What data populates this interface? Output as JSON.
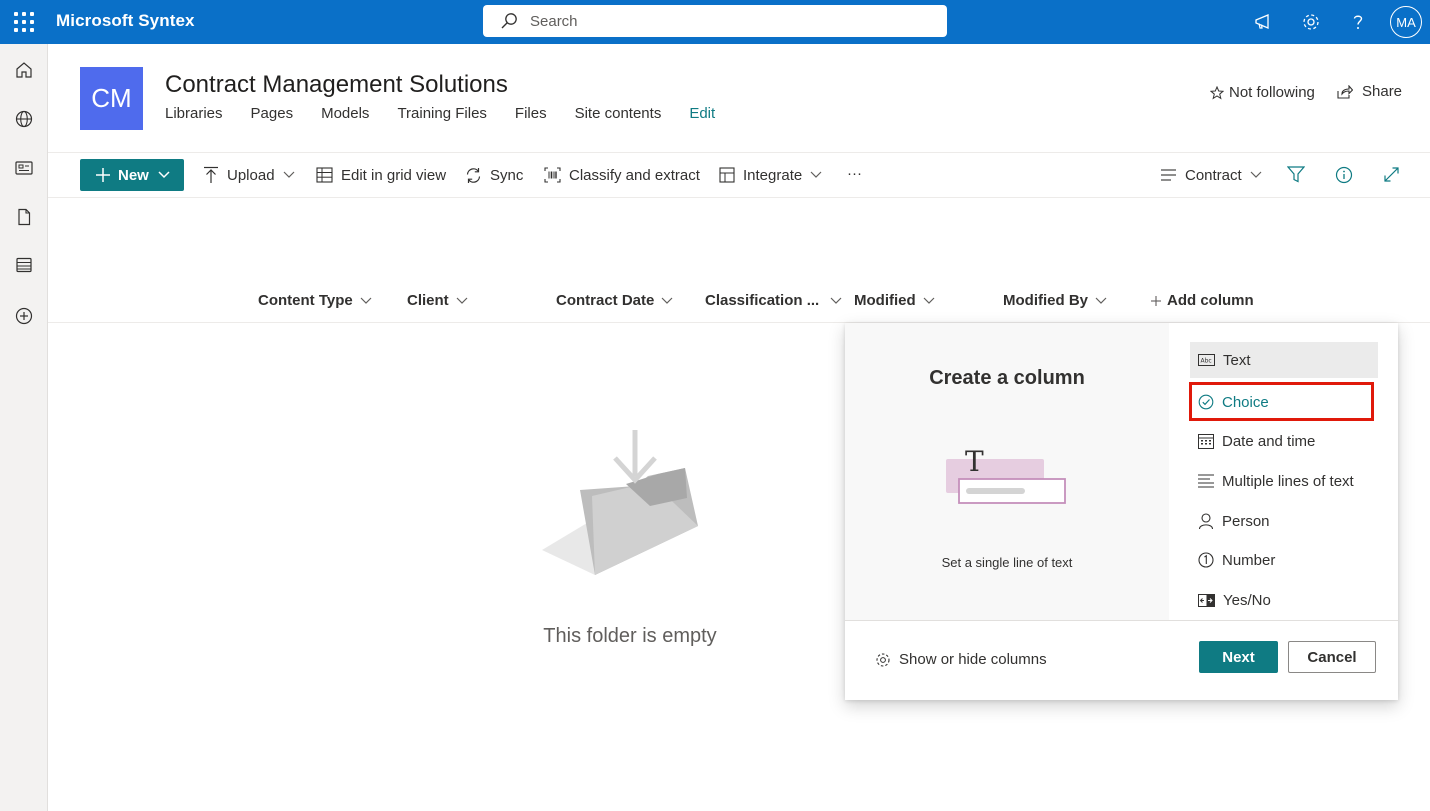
{
  "suitebar": {
    "app_name": "Microsoft Syntex",
    "search_placeholder": "Search",
    "avatar_initials": "MA"
  },
  "site": {
    "logo_text": "CM",
    "title": "Contract Management Solutions",
    "nav": [
      "Libraries",
      "Pages",
      "Models",
      "Training Files",
      "Files",
      "Site contents",
      "Edit"
    ],
    "follow_label": "Not following",
    "share_label": "Share"
  },
  "commandbar": {
    "new_label": "New",
    "upload_label": "Upload",
    "grid_label": "Edit in grid view",
    "sync_label": "Sync",
    "classify_label": "Classify and extract",
    "integrate_label": "Integrate",
    "more_label": "···",
    "view_label": "Contract"
  },
  "columns": [
    "Content Type",
    "Client",
    "Contract Date",
    "Classification ...",
    "Modified",
    "Modified By",
    "Add column"
  ],
  "empty_state": {
    "message": "This folder is empty"
  },
  "create_column_panel": {
    "title": "Create a column",
    "description": "Set a single line of text",
    "types": [
      "Text",
      "Choice",
      "Date and time",
      "Multiple lines of text",
      "Person",
      "Number",
      "Yes/No"
    ],
    "selected": "Text",
    "highlighted": "Choice",
    "show_hide_label": "Show or hide columns",
    "next_label": "Next",
    "cancel_label": "Cancel"
  },
  "colors": {
    "suitebar": "#0a70c8",
    "accent": "#0f7b83",
    "site_logo": "#4f6bed",
    "highlight": "#e0190a"
  }
}
